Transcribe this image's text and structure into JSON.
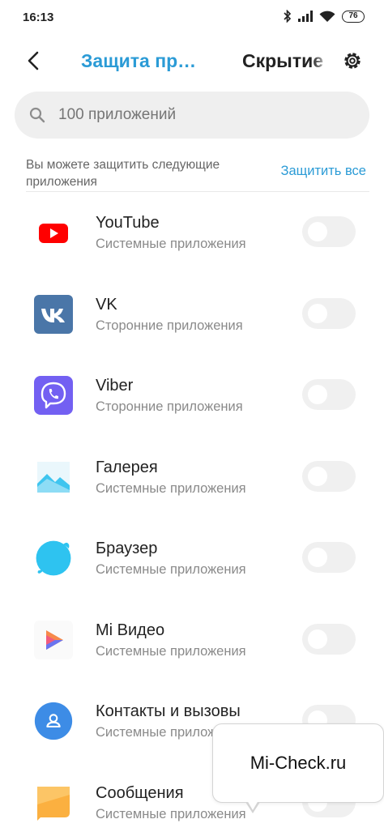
{
  "status_bar": {
    "time": "16:13",
    "battery": "76",
    "icons": [
      "bluetooth-icon",
      "signal-icon",
      "wifi-icon",
      "battery-icon"
    ]
  },
  "header": {
    "active_tab": "Защита пр…",
    "inactive_tab": "Скрытие",
    "back_icon": "back-arrow-icon",
    "settings_icon": "gear-icon"
  },
  "search": {
    "placeholder": "100 приложений",
    "icon": "search-icon"
  },
  "section": {
    "description": "Вы можете защитить следующие приложения",
    "action": "Защитить все"
  },
  "apps": [
    {
      "name": "YouTube",
      "type": "Системные приложения",
      "icon": "youtube-icon",
      "protected": false
    },
    {
      "name": "VK",
      "type": "Сторонние приложения",
      "icon": "vk-icon",
      "protected": false
    },
    {
      "name": "Viber",
      "type": "Сторонние приложения",
      "icon": "viber-icon",
      "protected": false
    },
    {
      "name": "Галерея",
      "type": "Системные приложения",
      "icon": "gallery-icon",
      "protected": false
    },
    {
      "name": "Браузер",
      "type": "Системные приложения",
      "icon": "browser-icon",
      "protected": false
    },
    {
      "name": "Mi Видео",
      "type": "Системные приложения",
      "icon": "mi-video-icon",
      "protected": false
    },
    {
      "name": "Контакты и вызовы",
      "type": "Системные приложения",
      "icon": "contacts-icon",
      "protected": false
    },
    {
      "name": "Сообщения",
      "type": "Системные приложения",
      "icon": "messages-icon",
      "protected": false
    }
  ],
  "watermark": {
    "text": "Mi-Check.ru"
  },
  "colors": {
    "accent": "#2b9bd6",
    "youtube": "#ff0000",
    "vk": "#4a76a8",
    "viber": "#7360f2",
    "browser": "#2ec3f0",
    "contacts": "#3d8ce6",
    "messages": "#fbb040"
  }
}
